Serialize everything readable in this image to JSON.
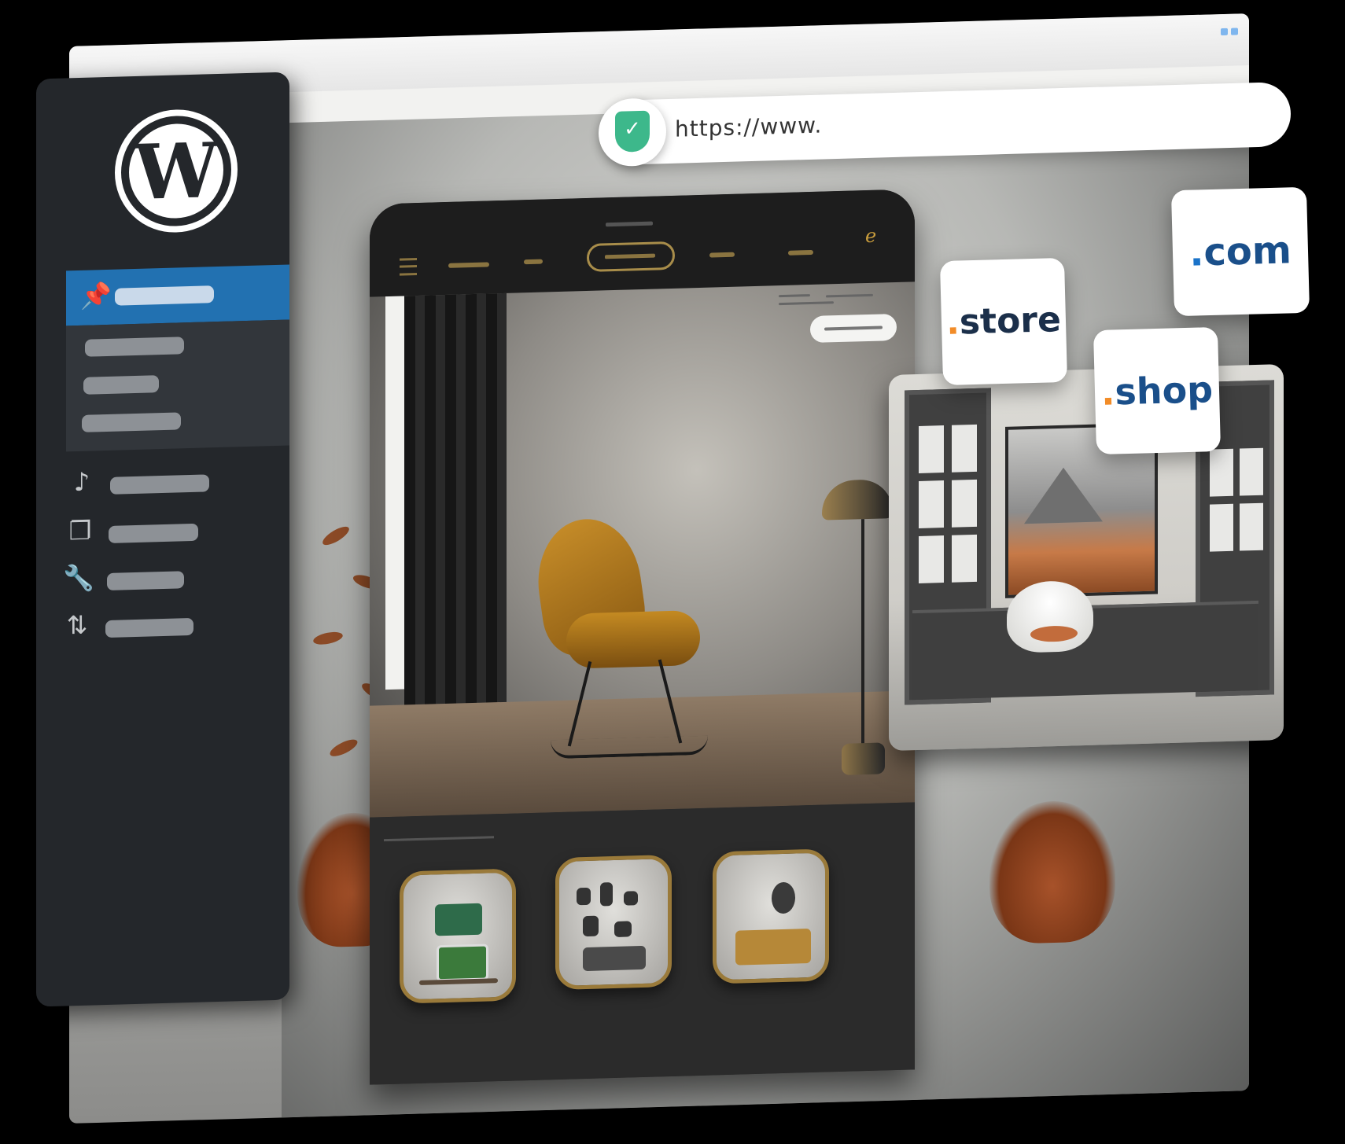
{
  "window": {
    "controls": [
      "window-dot",
      "window-dot"
    ]
  },
  "address_bar": {
    "url": "https://www.",
    "secure_icon": "shield-check-icon",
    "accent": "#3db88b"
  },
  "sidebar": {
    "logo": "wordpress-logo",
    "logo_letter": "W",
    "accent": "#2271b1",
    "items": [
      {
        "icon": "pin-icon",
        "active": true
      },
      {
        "icon": "none"
      },
      {
        "icon": "none"
      },
      {
        "icon": "none"
      },
      {
        "icon": "media-icon"
      },
      {
        "icon": "pages-icon"
      },
      {
        "icon": "wrench-icon"
      },
      {
        "icon": "import-export-icon"
      }
    ]
  },
  "mockup": {
    "brand_icon": "ℯ",
    "nav_accent": "#a88d4a",
    "hero_chair_color": "#c98f2a"
  },
  "domains": [
    {
      "dot": ".",
      "tld": "store",
      "dot_color": "#f28c28"
    },
    {
      "dot": ".",
      "tld": "com",
      "dot_color": "#1a73c9"
    },
    {
      "dot": ".",
      "tld": "shop",
      "dot_color": "#f28c28"
    }
  ]
}
